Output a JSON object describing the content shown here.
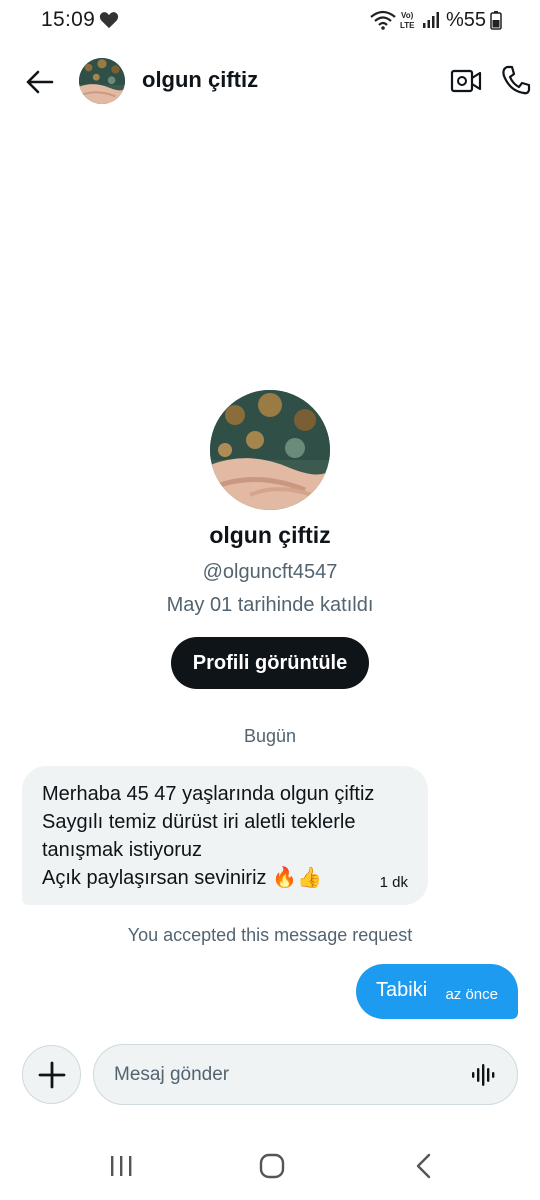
{
  "status_bar": {
    "time": "15:09",
    "battery_text": "%55",
    "icons": [
      "heart-icon",
      "wifi-icon",
      "volte-icon",
      "signal-icon",
      "battery-icon"
    ],
    "volte_text": "Vo) LTE"
  },
  "header": {
    "name": "olgun çiftiz",
    "icons": [
      "back-arrow-icon",
      "video-call-icon",
      "phone-call-icon"
    ]
  },
  "profile": {
    "name": "olgun çiftiz",
    "handle": "@olguncft4547",
    "joined": "May 01 tarihinde katıldı",
    "view_button": "Profili görüntüle"
  },
  "conversation": {
    "day_label": "Bugün",
    "incoming": {
      "lines": [
        "Merhaba 45 47 yaşlarında olgun çiftiz",
        "Saygılı temiz dürüst iri aletli teklerle",
        "tanışmak istiyoruz",
        "Açık paylaşırsan seviniriz 🔥👍"
      ],
      "time": "1 dk"
    },
    "system_note": "You accepted this message request",
    "outgoing": {
      "text": "Tabiki",
      "time": "az önce"
    }
  },
  "composer": {
    "placeholder": "Mesaj gönder",
    "value": ""
  },
  "colors": {
    "accent": "#1d9bf0",
    "text_primary": "#0f1419",
    "text_secondary": "#536471",
    "bubble_incoming": "#eff3f4",
    "button_dark": "#0f1419"
  }
}
